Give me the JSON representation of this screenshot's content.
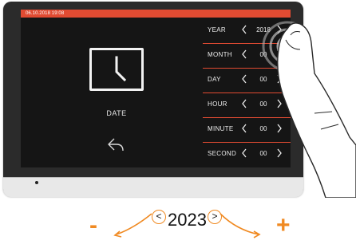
{
  "status_bar": {
    "datetime": "06.10.2018  19:08"
  },
  "panel": {
    "title": "DATE",
    "clock_icon": "clock-icon",
    "back_icon": "back-arrow-icon"
  },
  "menu": {
    "rows": [
      {
        "label": "YEAR",
        "value": "2018"
      },
      {
        "label": "MONTH",
        "value": "00"
      },
      {
        "label": "DAY",
        "value": "00"
      },
      {
        "label": "HOUR",
        "value": "00"
      },
      {
        "label": "MINUTE",
        "value": "00"
      },
      {
        "label": "SECOND",
        "value": "00"
      }
    ]
  },
  "illustration": {
    "year_value": "2023",
    "minus": "-",
    "plus": "+"
  },
  "colors": {
    "accent": "#e14b32",
    "orange": "#f08a22",
    "screen_bg": "#151515"
  }
}
